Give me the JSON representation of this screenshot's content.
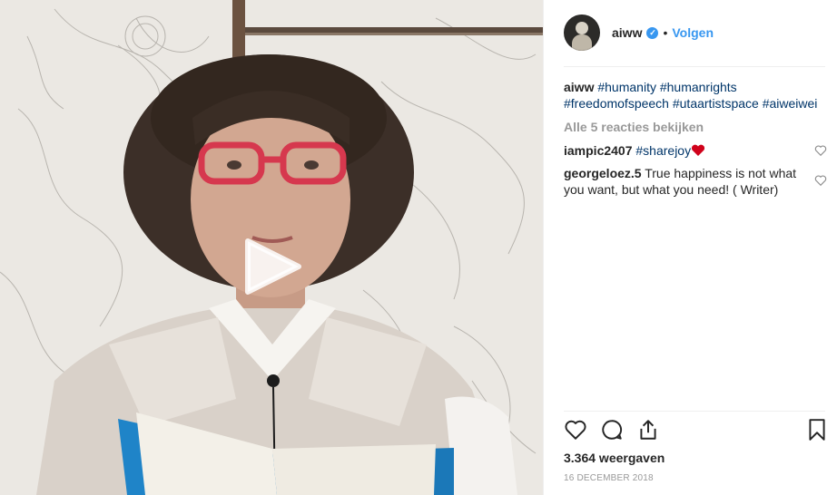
{
  "post": {
    "username": "aiww",
    "follow_label": "Volgen",
    "separator": "•",
    "caption_user": "aiww",
    "hashtags": [
      "#humanity",
      "#humanrights",
      "#freedomofspeech",
      "#utaartistspace",
      "#aiweiwei"
    ],
    "view_all_label": "Alle 5 reacties bekijken",
    "comments": [
      {
        "user": "iampic2407",
        "text": "#sharejoy",
        "emoji": "heart-emoji"
      },
      {
        "user": "georgeloez.5",
        "text": "True happiness is not what you want, but what you need! ( Writer)"
      }
    ],
    "views": "3.364 weergaven",
    "date": "16 DECEMBER 2018"
  },
  "colors": {
    "link": "#3897f0",
    "hashtag": "#003569",
    "muted": "#999999",
    "text": "#262626",
    "heart": "#ed4956"
  },
  "icons": [
    "verified-badge-icon",
    "play-icon",
    "heart-icon",
    "comment-icon",
    "share-icon",
    "bookmark-icon"
  ]
}
